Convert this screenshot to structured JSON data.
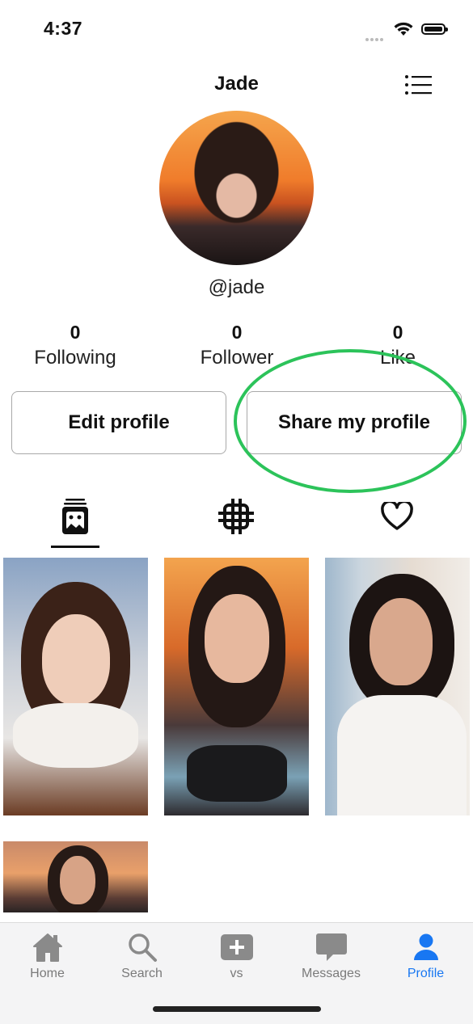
{
  "status": {
    "time": "4:37"
  },
  "header": {
    "title": "Jade"
  },
  "profile": {
    "handle": "@jade"
  },
  "stats": [
    {
      "value": "0",
      "label": "Following"
    },
    {
      "value": "0",
      "label": "Follower"
    },
    {
      "value": "0",
      "label": "Like"
    }
  ],
  "actions": {
    "edit_label": "Edit profile",
    "share_label": "Share my profile"
  },
  "tabs": [
    {
      "icon": "posts-icon",
      "selected": true
    },
    {
      "icon": "grid-crop-icon",
      "selected": false
    },
    {
      "icon": "heart-icon",
      "selected": false
    }
  ],
  "nav": [
    {
      "label": "Home",
      "icon": "home-icon"
    },
    {
      "label": "Search",
      "icon": "search-icon"
    },
    {
      "label": "vs",
      "icon": "plus-square-icon"
    },
    {
      "label": "Messages",
      "icon": "message-icon"
    },
    {
      "label": "Profile",
      "icon": "profile-icon",
      "active": true
    }
  ],
  "colors": {
    "accent": "#1877f2",
    "highlight": "#2cc35a",
    "inactive": "#7a7a7a"
  }
}
